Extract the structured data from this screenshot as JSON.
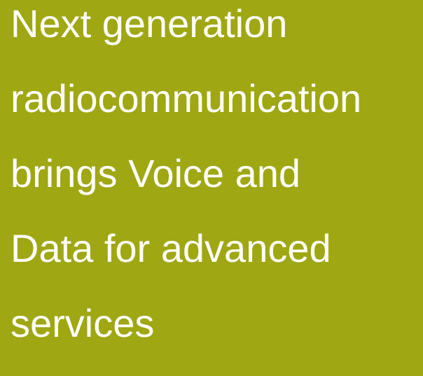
{
  "banner": {
    "background_color": "#9fa712",
    "text_color": "#ffffff",
    "headline_lines": [
      "Next generation",
      "radiocommunication",
      "brings Voice and",
      "Data for advanced",
      "services"
    ]
  }
}
